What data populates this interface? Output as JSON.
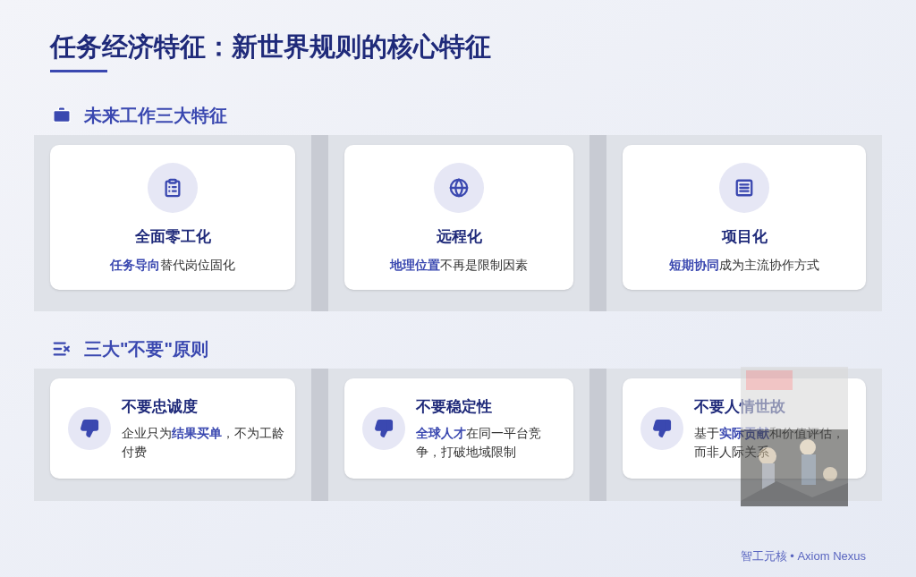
{
  "title": "任务经济特征：新世界规则的核心特征",
  "section_1": {
    "heading": "未来工作三大特征",
    "features": [
      {
        "title": "全面零工化",
        "desc": "**任务导向**替代岗位固化"
      },
      {
        "title": "远程化",
        "desc": "**地理位置**不再是限制因素"
      },
      {
        "title": "项目化",
        "desc": "**短期协同**成为主流协作方式"
      }
    ]
  },
  "section_2": {
    "heading": "三大\"不要\"原则",
    "principles": [
      {
        "title": "不要忠诚度",
        "desc": "企业只为**结果买单**，不为工龄付费"
      },
      {
        "title": "不要稳定性",
        "desc": "**全球人才**在同一平台竞争，打破地域限制"
      },
      {
        "title": "不要人情世故",
        "desc": "基于**实际贡献**和价值评估，而非人际关系"
      }
    ]
  },
  "footer": "智工元核 • Axiom Nexus"
}
